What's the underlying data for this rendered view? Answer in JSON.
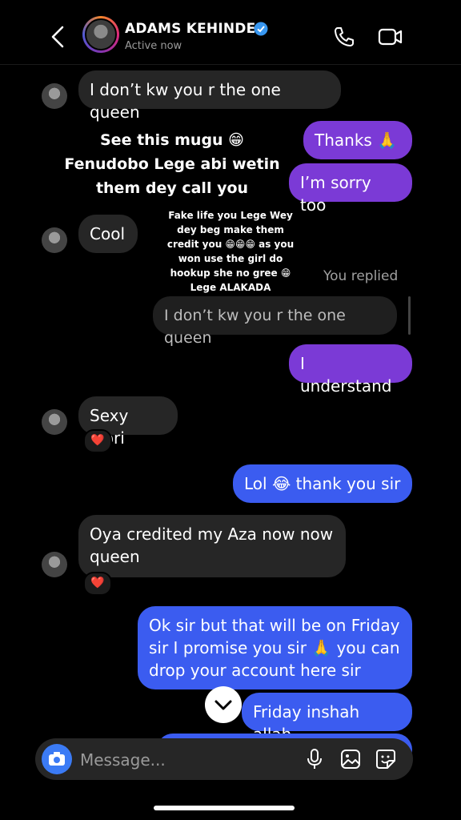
{
  "header": {
    "name": "ADAMS KEHINDE",
    "status": "Active now"
  },
  "messages": {
    "m1": "I don’t kw you r the one queen",
    "m2": "Thanks 🙏",
    "m3": "I’m sorry too",
    "m4": "Cool",
    "quoted": "I don’t kw you r the one queen",
    "replied_label": "You replied",
    "m5": "I understand",
    "m6": "Sexy olori",
    "m7": "Lol 😂 thank you sir",
    "m8": "Oya credited my Aza now now queen",
    "m9": "Ok sir but that will be on Friday sir I promise you sir 🙏 you can drop your account here sir",
    "m10": "Friday inshah allah"
  },
  "reactions": {
    "r1": "❤️",
    "r2": "❤️"
  },
  "overlay": {
    "big": "See this mugu 😁 Fenudobo Lege abi wetin them dey call you",
    "small": "Fake life you Lege Wey dey beg make them credit you 😁😁😁 as you won use the girl do hookup she no gree 😁 Lege ALAKADA"
  },
  "composer": {
    "placeholder": "Message..."
  },
  "colors": {
    "outgoing_purple": "#7b3ad6",
    "outgoing_blue": "#3b5cf0",
    "incoming": "#262626",
    "verified": "#3897f0"
  }
}
